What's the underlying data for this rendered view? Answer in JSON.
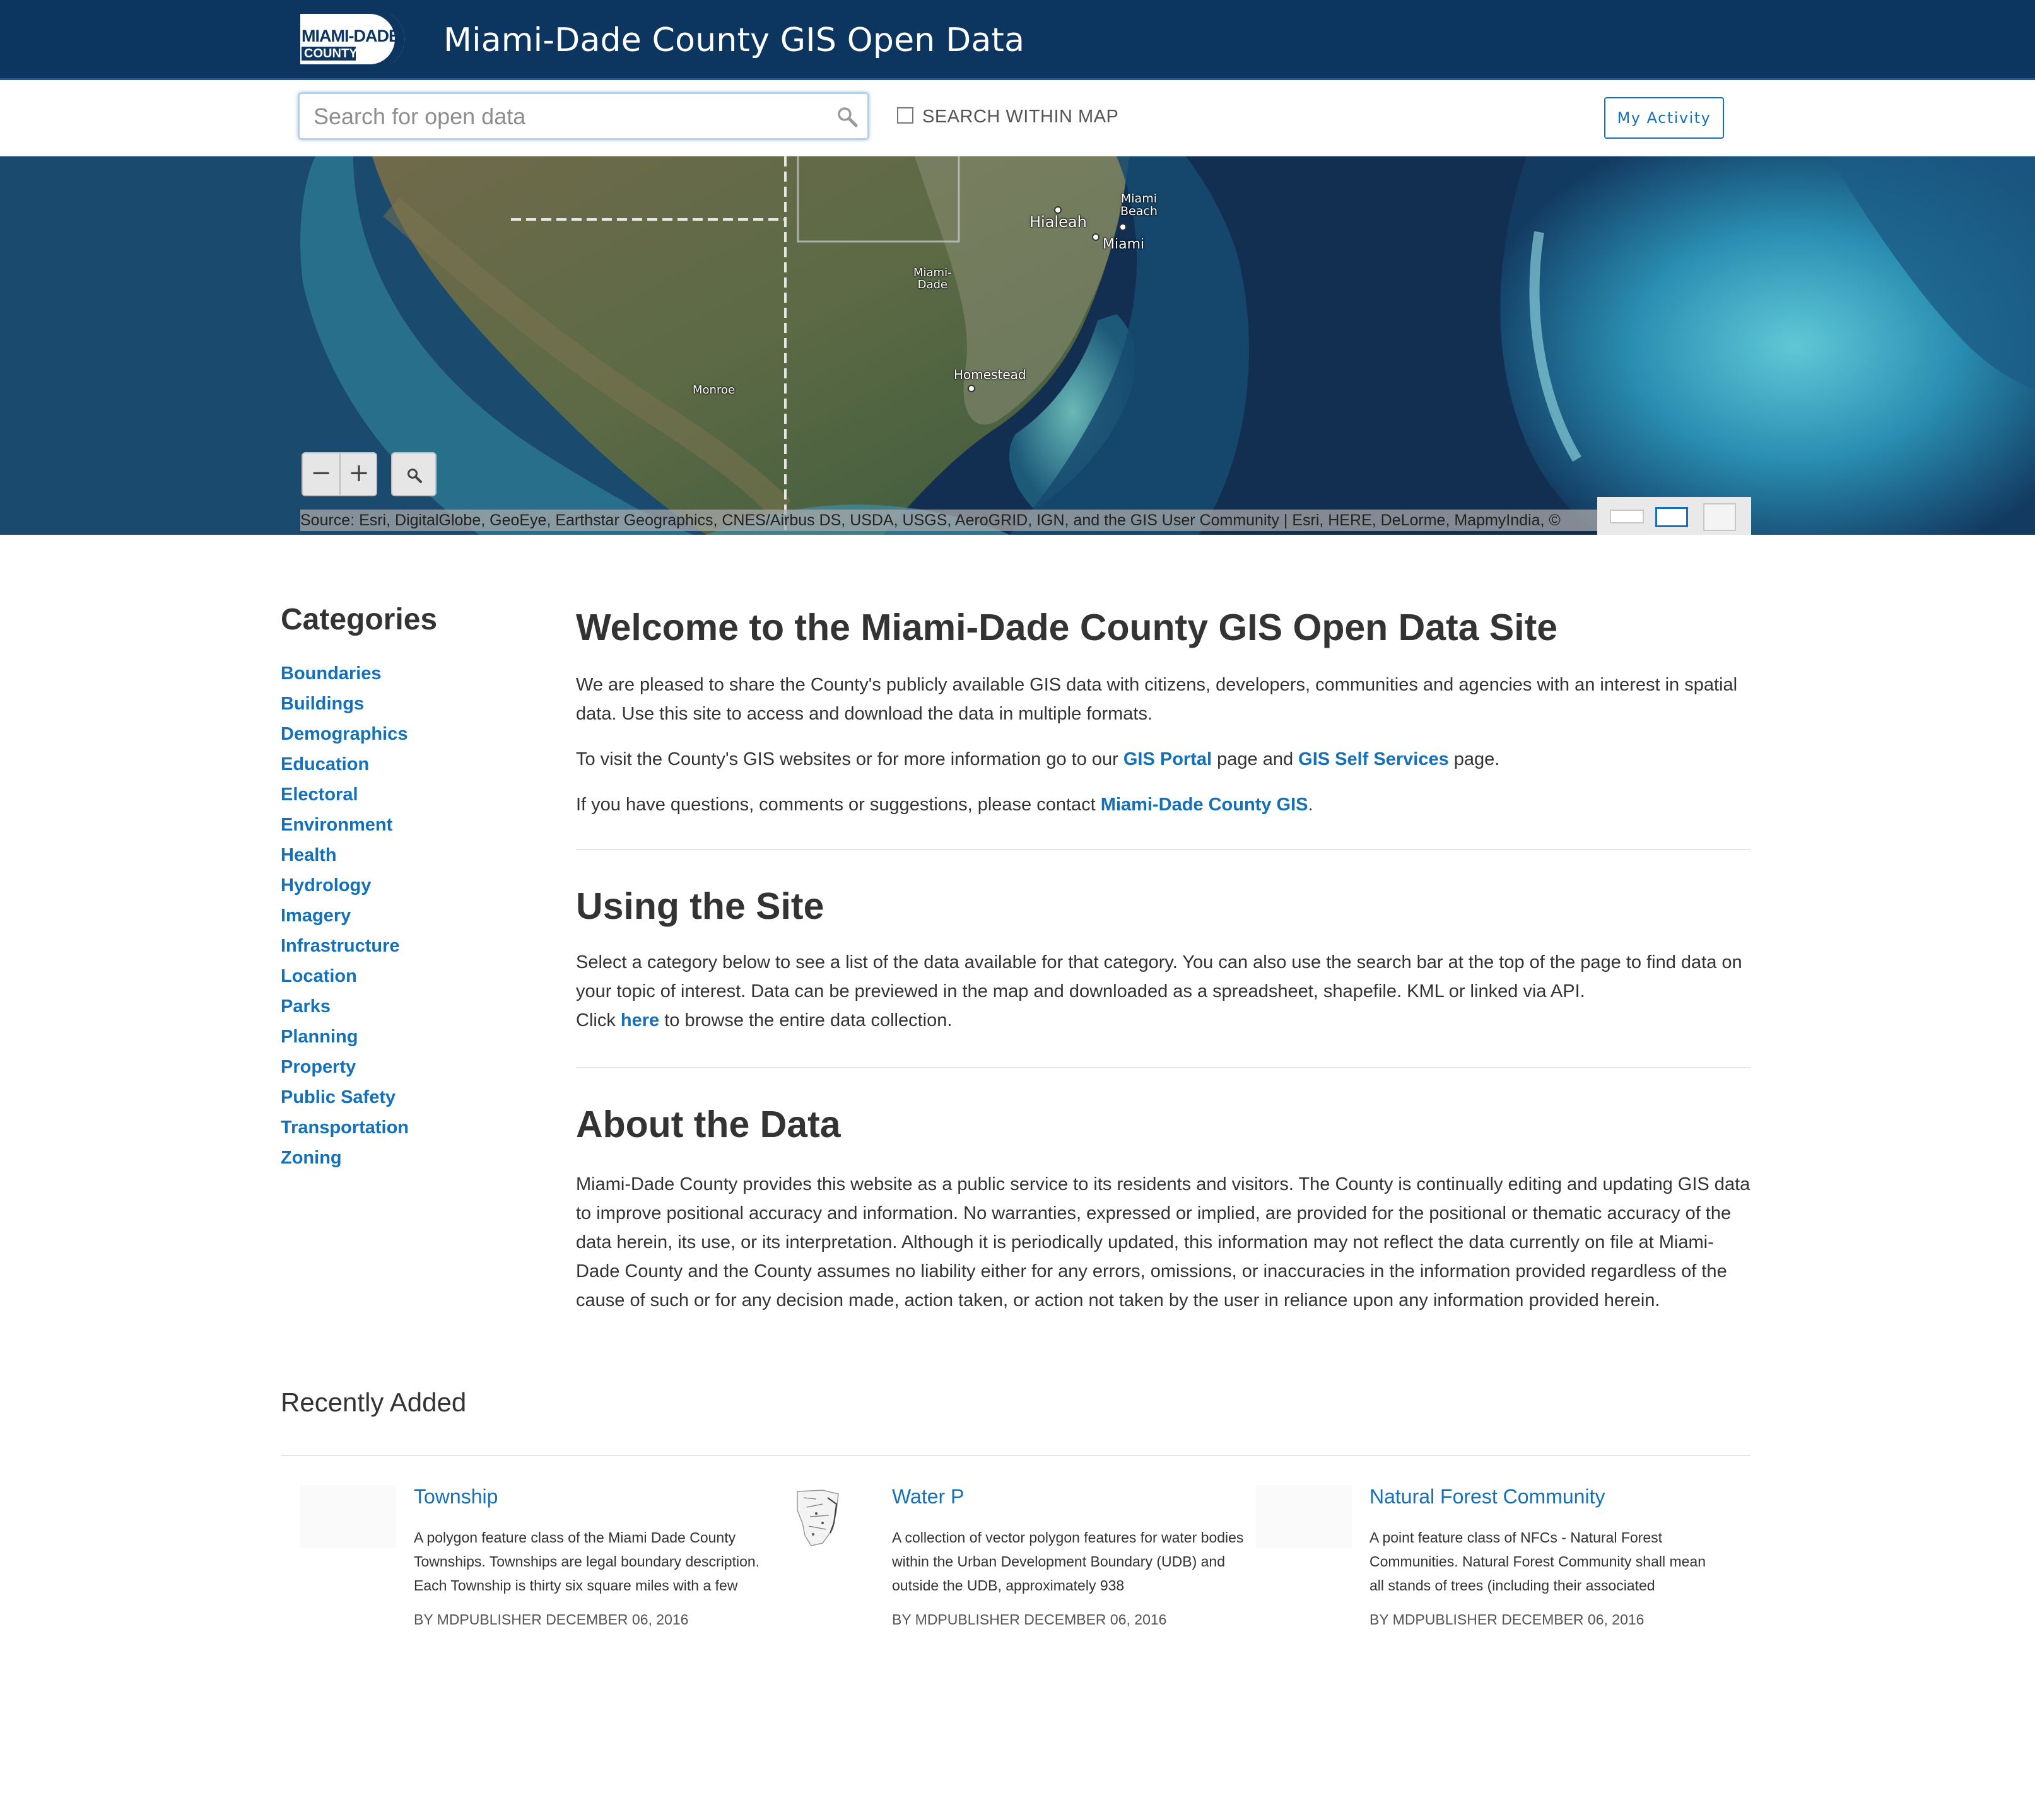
{
  "header": {
    "logo_line1": "MIAMI-DADE",
    "logo_line2": "COUNTY",
    "title": "Miami-Dade County GIS Open Data"
  },
  "search": {
    "placeholder": "Search for open data",
    "within_map_label": "SEARCH WITHIN MAP",
    "my_activity_label": "My Activity"
  },
  "map": {
    "cities": {
      "miami_beach": "Miami\nBeach",
      "hialeah": "Hialeah",
      "miami": "Miami",
      "miami_dade": "Miami-\nDade",
      "homestead": "Homestead",
      "monroe": "Monroe"
    },
    "zoom_out": "−",
    "zoom_in": "+",
    "attribution": "Source: Esri, DigitalGlobe, GeoEye, Earthstar Geographics, CNES/Airbus DS, USDA, USGS, AeroGRID, IGN, and the GIS User Community |  Esri, HERE, DeLorme, MapmyIndia, ©"
  },
  "categories": {
    "heading": "Categories",
    "items": [
      "Boundaries",
      "Buildings",
      "Demographics",
      "Education",
      "Electoral",
      "Environment",
      "Health",
      "Hydrology",
      "Imagery",
      "Infrastructure",
      "Location",
      "Parks",
      "Planning",
      "Property",
      "Public Safety",
      "Transportation",
      "Zoning"
    ]
  },
  "welcome": {
    "title": "Welcome to the Miami-Dade County GIS Open Data Site",
    "para1": "We are pleased to share the County's publicly available GIS data with citizens, developers, communities and agencies with an interest in spatial data. Use this site to access and download the data in multiple formats.",
    "para2_prefix": "To visit the County's GIS websites or for more information go to our ",
    "gis_portal_link": "GIS Portal",
    "para2_middle": " page and ",
    "gis_self_services_link": "GIS Self Services",
    "para2_suffix": " page.",
    "para3_prefix": "If you have questions, comments or suggestions, please contact ",
    "contact_link": "Miami-Dade County GIS",
    "para3_suffix": "."
  },
  "using": {
    "title": "Using the Site",
    "para": "Select a category below to see a list of the data available for that category. You can also use the search bar at the top of the page to find data on your topic of interest. Data can be previewed in the map and downloaded as a spreadsheet, shapefile. KML or linked via API.",
    "click_prefix": "Click ",
    "here_link": "here",
    "click_suffix": " to browse the entire data collection."
  },
  "about": {
    "title": "About the Data",
    "para": "Miami-Dade County provides this website as a public service to its residents and visitors. The County is continually editing and updating GIS data to improve positional accuracy and information. No warranties, expressed or implied, are provided for the positional or thematic accuracy of the data herein, its use, or its interpretation. Although it is periodically updated, this information may not reflect the data currently on file at Miami-Dade County and the County assumes no liability either for any errors, omissions, or inaccuracies in the information provided regardless of the cause of such or for any decision made, action taken, or action not taken by the user in reliance upon any information provided herein."
  },
  "recent": {
    "heading": "Recently Added",
    "items": [
      {
        "title": "Township",
        "description": "A polygon feature class of the Miami Dade County Townships. Townships are legal boundary description. Each Township is thirty six square miles with a few",
        "meta": "BY MDPUBLISHER DECEMBER 06, 2016"
      },
      {
        "title": "Water P",
        "description": "A collection of vector polygon features for water bodies within the Urban Development Boundary (UDB) and outside the UDB, approximately 938",
        "meta": "BY MDPUBLISHER DECEMBER 06, 2016"
      },
      {
        "title": "Natural Forest Community",
        "description": "A point feature class of NFCs - Natural Forest Communities. Natural Forest Community shall mean all stands of trees (including their associated",
        "meta": "BY MDPUBLISHER DECEMBER 06, 2016"
      }
    ]
  },
  "colors": {
    "header_bg": "#0c355f",
    "link": "#1570b8"
  },
  "icons": [
    "search-icon",
    "checkbox-icon",
    "map-search-icon",
    "basemap-icon"
  ]
}
